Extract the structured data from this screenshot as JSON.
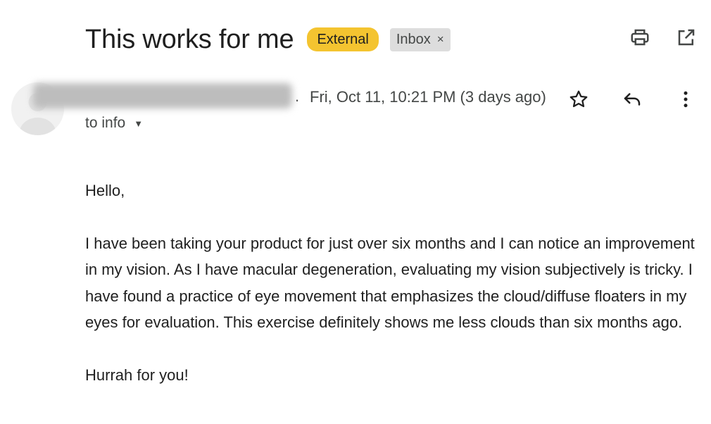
{
  "email": {
    "subject": "This works for me",
    "labels": {
      "external": "External",
      "inbox": "Inbox",
      "inbox_remove": "×"
    },
    "sender_hidden": ".",
    "date": "Fri, Oct 11, 10:21 PM (3 days ago)",
    "recipient": "to info",
    "recipient_caret": "▼",
    "body": {
      "greeting": "Hello,",
      "paragraph": "I have been taking your product for just over six months and I can notice an improvement in my vision.  As I have macular degeneration, evaluating my vision subjectively is tricky.  I have found a practice of eye movement that emphasizes the cloud/diffuse floaters in my eyes for evaluation.  This exercise definitely shows me less clouds than six months ago.",
      "closing": "Hurrah for you!"
    }
  },
  "icons": {
    "print": "print-icon",
    "open_new_window": "open-in-new-window-icon",
    "star": "star-icon",
    "reply": "reply-icon",
    "more": "more-vertical-icon",
    "avatar": "avatar-placeholder-icon"
  },
  "colors": {
    "external_label": "#f4c430",
    "inbox_label": "#dddddd",
    "text": "#1f1f1f",
    "secondary_text": "#444746"
  }
}
